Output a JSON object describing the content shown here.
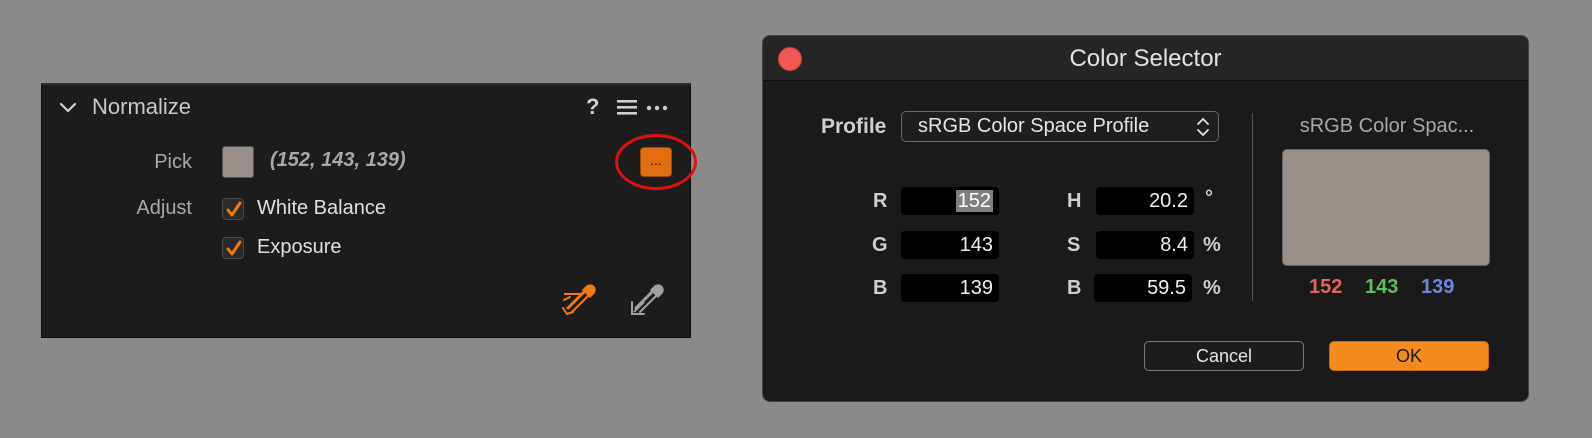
{
  "panel": {
    "title": "Normalize",
    "header_icons": [
      "help-icon",
      "list-icon",
      "more-icon"
    ],
    "help_glyph": "?",
    "pick_label": "Pick",
    "pick_value": "(152, 143, 139)",
    "pick_button_label": "...",
    "adjust_label": "Adjust",
    "checkboxes": [
      {
        "label": "White Balance",
        "checked": true
      },
      {
        "label": "Exposure",
        "checked": true
      }
    ],
    "swatch_color": "#988f8b",
    "accent_color": "#e36e12"
  },
  "dialog": {
    "title": "Color Selector",
    "profile_label": "Profile",
    "profile_value": "sRGB Color Space Profile",
    "rgb": [
      {
        "label": "R",
        "value": "152"
      },
      {
        "label": "G",
        "value": "143"
      },
      {
        "label": "B",
        "value": "139"
      }
    ],
    "hsb": [
      {
        "label": "H",
        "value": "20.2",
        "unit": "°"
      },
      {
        "label": "S",
        "value": "8.4",
        "unit": "%"
      },
      {
        "label": "B",
        "value": "59.5",
        "unit": "%"
      }
    ],
    "preview_title": "sRGB Color Spac...",
    "preview_color": "#988f8b",
    "preview_values": [
      {
        "value": "152",
        "color": "#e06464"
      },
      {
        "value": "143",
        "color": "#5cc05c"
      },
      {
        "value": "139",
        "color": "#6f86e0"
      }
    ],
    "cancel_label": "Cancel",
    "ok_label": "OK",
    "ok_color": "#f58a1f"
  }
}
